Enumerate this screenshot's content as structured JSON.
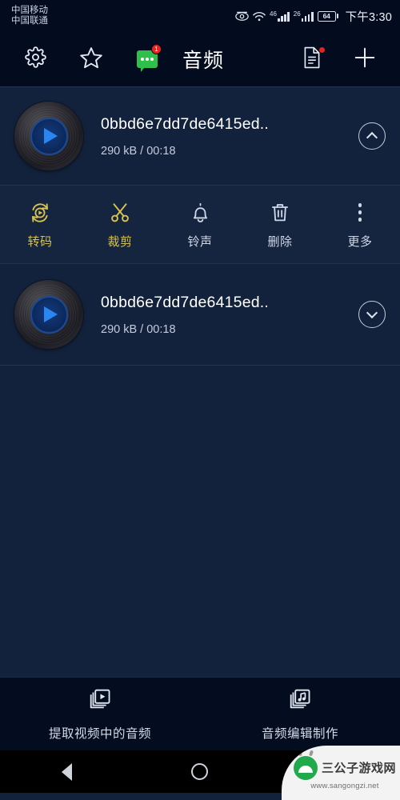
{
  "status_bar": {
    "carrier_line1": "中国移动",
    "carrier_line2": "中国联通",
    "eye_icon": "eye-care-icon",
    "wifi_icon": "wifi-icon",
    "sim1_label": "46",
    "sim2_label": "26",
    "battery_level": "64",
    "time": "下午3:30"
  },
  "toolbar": {
    "settings_icon": "gear-icon",
    "favorite_icon": "star-icon",
    "chat_icon": "chat-bubble-icon",
    "chat_badge": "1",
    "title": "音频",
    "document_icon": "document-icon",
    "add_icon": "plus-icon"
  },
  "list": {
    "items": [
      {
        "title": "0bbd6e7dd7de6415ed..",
        "meta": "290 kB / 00:18",
        "thumb_icon": "vinyl-record-play-icon",
        "expand_icon": "chevron-up-icon",
        "expanded": "true"
      },
      {
        "title": "0bbd6e7dd7de6415ed..",
        "meta": "290 kB / 00:18",
        "thumb_icon": "vinyl-record-play-icon",
        "expand_icon": "chevron-down-icon",
        "expanded": "false"
      }
    ]
  },
  "actions": [
    {
      "label": "转码",
      "icon": "transcode-icon",
      "color": "#d6c24e"
    },
    {
      "label": "裁剪",
      "icon": "scissors-icon",
      "color": "#d6c24e"
    },
    {
      "label": "铃声",
      "icon": "bell-icon",
      "color": "#cfd8e6"
    },
    {
      "label": "删除",
      "icon": "trash-icon",
      "color": "#cfd8e6"
    },
    {
      "label": "更多",
      "icon": "more-vertical-icon",
      "color": "#cfd8e6"
    }
  ],
  "bottom_bar": {
    "items": [
      {
        "label": "提取视频中的音频",
        "icon": "video-extract-icon"
      },
      {
        "label": "音频编辑制作",
        "icon": "music-note-icon"
      }
    ]
  },
  "nav_bar": {
    "back_icon": "back-triangle-icon",
    "home_icon": "home-circle-icon",
    "recents_icon": "recents-square-icon"
  },
  "watermark": {
    "name": "三公子游戏网",
    "url": "www.sangongzi.net",
    "logo_icon": "android-robot-icon"
  },
  "colors": {
    "page_background": "#13223c",
    "bar_background": "#030b1e",
    "accent_gold": "#d6c24e",
    "accent_blue": "#2a86f0",
    "badge_red": "#e8231f",
    "chat_green": "#2fbf4a"
  }
}
